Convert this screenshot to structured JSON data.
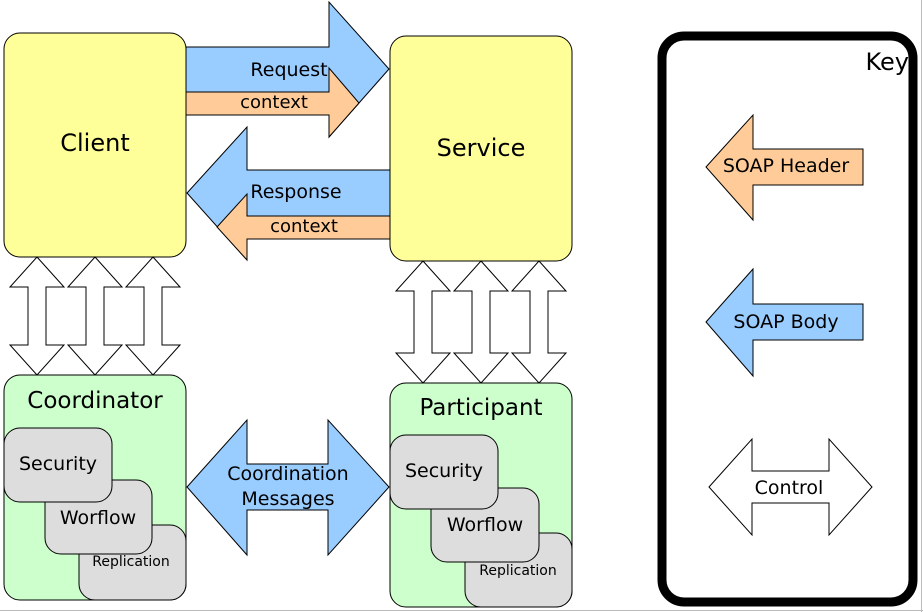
{
  "colors": {
    "component_fill": "#ffff99",
    "extension_fill": "#ccffcc",
    "module_fill": "#dddddd",
    "soap_body": "#99ccff",
    "soap_header": "#ffcc99",
    "control": "#ffffff",
    "stroke": "#000000"
  },
  "nodes": {
    "client": "Client",
    "service": "Service",
    "coordinator": "Coordinator",
    "participant": "Participant"
  },
  "coordinator_modules": [
    "Security",
    "Worflow",
    "Replication"
  ],
  "participant_modules": [
    "Security",
    "Worflow",
    "Replication"
  ],
  "arrows": {
    "request": "Request",
    "request_context": "context",
    "response": "Response",
    "response_context": "context",
    "coordination_line1": "Coordination",
    "coordination_line2": "Messages"
  },
  "key": {
    "title": "Key",
    "items": [
      {
        "label": "SOAP Header",
        "type": "soap-header"
      },
      {
        "label": "SOAP Body",
        "type": "soap-body"
      },
      {
        "label": "Control",
        "type": "control"
      }
    ]
  }
}
